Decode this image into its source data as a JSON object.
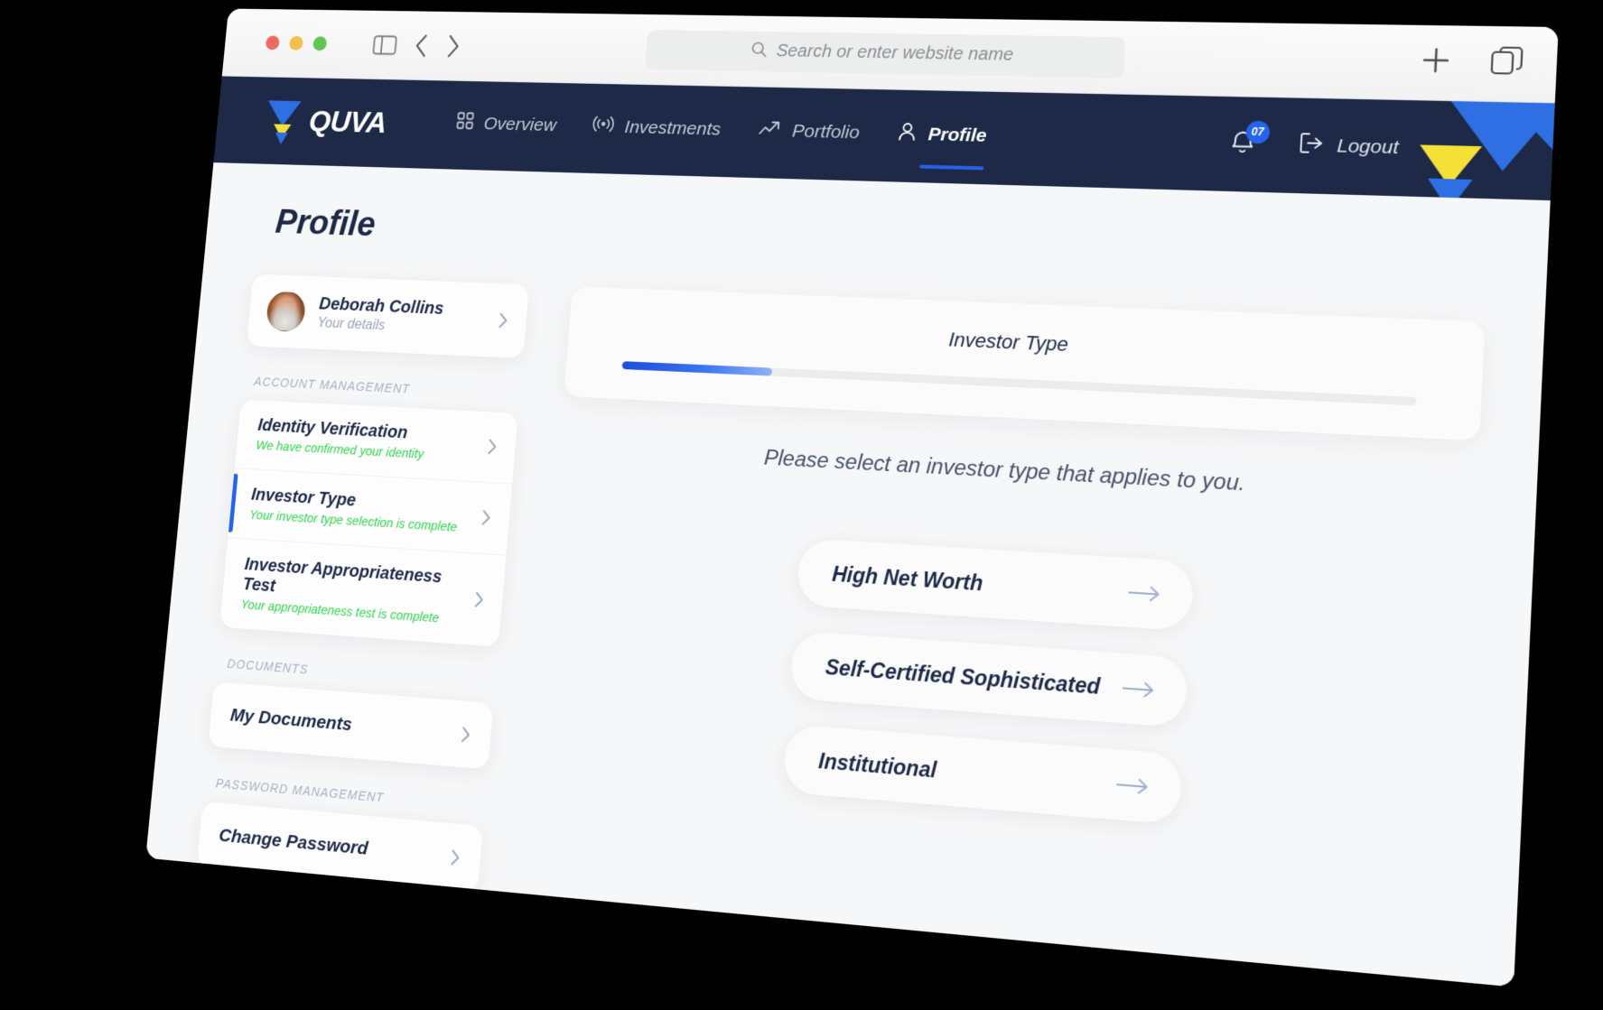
{
  "browser": {
    "address_placeholder": "Search or enter website name",
    "search_icon": "search-icon",
    "back_icon": "chevron-left-icon",
    "forward_icon": "chevron-right-icon",
    "sidebar_toggle_icon": "sidebar-toggle-icon",
    "new_tab_icon": "plus-icon",
    "tab_overview_icon": "copy-tabs-icon"
  },
  "nav": {
    "brand": "QUVA",
    "links": [
      {
        "label": "Overview",
        "icon": "grid-icon",
        "active": false
      },
      {
        "label": "Investments",
        "icon": "broadcast-icon",
        "active": false
      },
      {
        "label": "Portfolio",
        "icon": "trending-up-icon",
        "active": false
      },
      {
        "label": "Profile",
        "icon": "user-icon",
        "active": true
      }
    ],
    "notifications": {
      "icon": "bell-icon",
      "count": "07"
    },
    "logout": {
      "label": "Logout",
      "icon": "logout-icon"
    }
  },
  "page": {
    "title": "Profile"
  },
  "sidebar": {
    "profile": {
      "name": "Deborah Collins",
      "subtitle": "Your details",
      "avatar": "user-avatar",
      "chevron": "chevron-right-icon"
    },
    "groups": [
      {
        "label": "ACCOUNT MANAGEMENT",
        "items": [
          {
            "title": "Identity Verification",
            "status": "We have confirmed your identity",
            "active": false
          },
          {
            "title": "Investor Type",
            "status": "Your investor type selection is complete",
            "active": true
          },
          {
            "title": "Investor Appropriateness Test",
            "status": "Your appropriateness test is complete",
            "active": false
          }
        ]
      },
      {
        "label": "DOCUMENTS",
        "items": [
          {
            "title": "My Documents",
            "status": "",
            "active": false
          }
        ]
      },
      {
        "label": "PASSWORD MANAGEMENT",
        "items": [
          {
            "title": "Change Password",
            "status": "",
            "active": false
          }
        ]
      }
    ]
  },
  "main": {
    "panel_title": "Investor Type",
    "progress_percent": 20,
    "instruction": "Please select an investor type that applies to you.",
    "options": [
      {
        "label": "High Net Worth",
        "arrow": "arrow-right-icon"
      },
      {
        "label": "Self-Certified Sophisticated",
        "arrow": "arrow-right-icon"
      },
      {
        "label": "Institutional",
        "arrow": "arrow-right-icon"
      }
    ]
  },
  "colors": {
    "nav_background": "#1d2947",
    "accent_blue": "#2563eb",
    "status_green": "#2fd44b",
    "logo_yellow": "#f5e038",
    "page_background": "#f6f7f8"
  }
}
